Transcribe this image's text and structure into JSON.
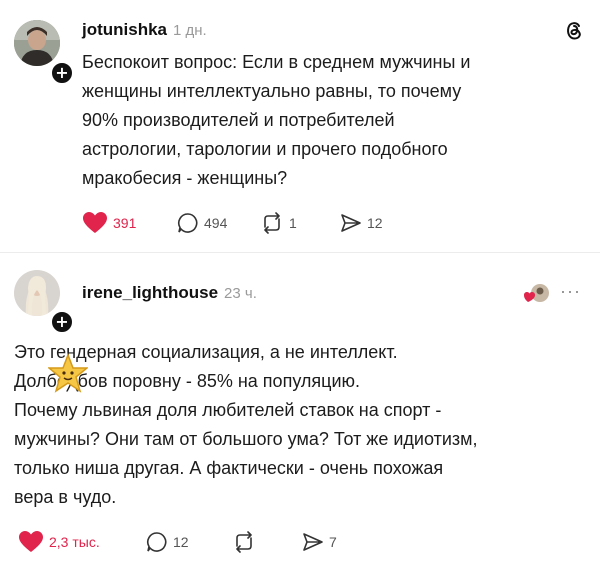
{
  "app_icon": "threads-icon",
  "post1": {
    "username": "jotunishka",
    "time": "1 дн.",
    "lines": [
      "Беспокоит вопрос: Если в среднем мужчины и",
      "женщины интеллектуально равны, то почему",
      "90% производителей и потребителей",
      "астрологии, тарологии и прочего подобного",
      "мракобесия - женщины?"
    ],
    "likes": "391",
    "comments": "494",
    "reposts": "1",
    "shares": "12"
  },
  "post2": {
    "username": "irene_lighthouse",
    "time": "23 ч.",
    "more": "···",
    "lines": [
      "Это гендерная социализация, а не интеллект.",
      "Долбо╳бов поровну - 85% на популяцию.",
      " Почему львиная доля любителей ставок на спорт -",
      "мужчины? Они там от большого ума? Тот же идиотизм,",
      "только ниша другая. А фактически - очень похожая",
      "вера в чудо."
    ],
    "likes": "2,3 тыс.",
    "comments": "12",
    "reposts": "",
    "shares": "7"
  },
  "colors": {
    "like": "#e0244c",
    "text": "#1c1c1c",
    "muted": "#9a9a9a"
  }
}
